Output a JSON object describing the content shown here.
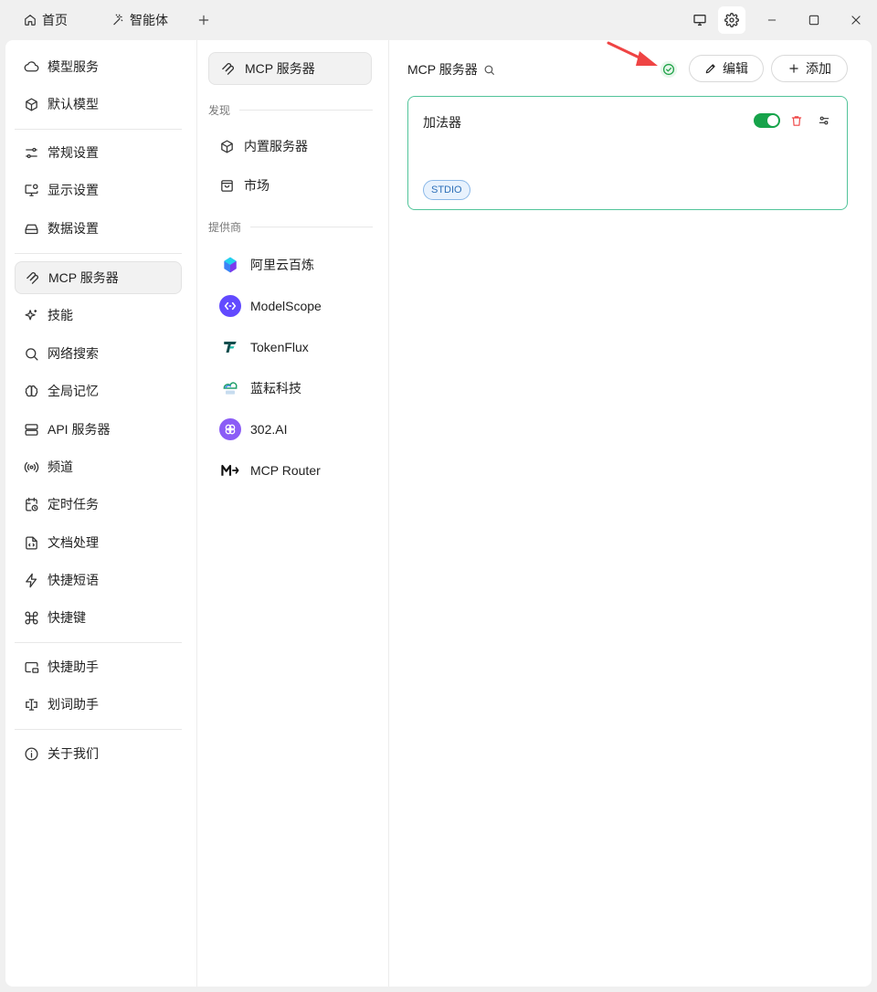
{
  "titlebar": {
    "tabs": [
      {
        "label": "首页",
        "icon": "home-icon"
      },
      {
        "label": "智能体",
        "icon": "magic-wand-icon"
      }
    ],
    "new_tab_icon": "plus-icon",
    "right_icons": [
      "monitor-icon",
      "gear-icon",
      "minimize-icon",
      "maximize-icon",
      "close-icon"
    ]
  },
  "sidebar": {
    "items": [
      {
        "label": "模型服务",
        "icon": "cloud-icon"
      },
      {
        "label": "默认模型",
        "icon": "cube-icon"
      },
      {
        "label": "常规设置",
        "icon": "sliders-icon"
      },
      {
        "label": "显示设置",
        "icon": "monitor-settings-icon"
      },
      {
        "label": "数据设置",
        "icon": "hard-drive-icon"
      },
      {
        "label": "MCP 服务器",
        "icon": "mcp-icon",
        "active": true
      },
      {
        "label": "技能",
        "icon": "sparkles-icon"
      },
      {
        "label": "网络搜索",
        "icon": "search-icon"
      },
      {
        "label": "全局记忆",
        "icon": "brain-icon"
      },
      {
        "label": "API 服务器",
        "icon": "server-icon"
      },
      {
        "label": "频道",
        "icon": "radio-icon"
      },
      {
        "label": "定时任务",
        "icon": "calendar-clock-icon"
      },
      {
        "label": "文档处理",
        "icon": "file-code-icon"
      },
      {
        "label": "快捷短语",
        "icon": "zap-icon"
      },
      {
        "label": "快捷键",
        "icon": "command-icon"
      },
      {
        "label": "快捷助手",
        "icon": "picture-in-picture-icon"
      },
      {
        "label": "划词助手",
        "icon": "text-cursor-icon"
      },
      {
        "label": "关于我们",
        "icon": "info-icon"
      }
    ]
  },
  "mcp_nav": {
    "main_label": "MCP 服务器",
    "discover_label": "发现",
    "discover_items": [
      {
        "label": "内置服务器",
        "icon": "package-icon"
      },
      {
        "label": "市场",
        "icon": "shopping-bag-icon"
      }
    ],
    "providers_label": "提供商",
    "providers": [
      {
        "label": "阿里云百炼",
        "icon": "bailian-logo-icon"
      },
      {
        "label": "ModelScope",
        "icon": "modelscope-logo-icon"
      },
      {
        "label": "TokenFlux",
        "icon": "tokenflux-logo-icon"
      },
      {
        "label": "蓝耘科技",
        "icon": "lanyun-logo-icon"
      },
      {
        "label": "302.AI",
        "icon": "ai302-logo-icon"
      },
      {
        "label": "MCP Router",
        "icon": "mcp-router-logo-icon"
      }
    ]
  },
  "content": {
    "title": "MCP 服务器",
    "edit_label": "编辑",
    "add_label": "添加",
    "server": {
      "name": "加法器",
      "enabled": true,
      "type_badge": "STDIO"
    }
  },
  "colors": {
    "accent_green": "#16a34a",
    "card_border": "#52c49a",
    "delete_red": "#ef4444",
    "arrow_red": "#ef4444",
    "badge_blue": "#2d6fb8"
  }
}
